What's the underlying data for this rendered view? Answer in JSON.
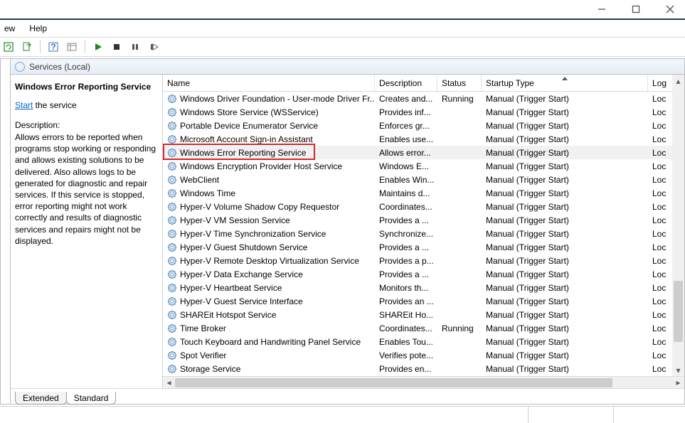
{
  "menubar": {
    "view": "ew",
    "help": "Help"
  },
  "services_header": "Services (Local)",
  "detail": {
    "title": "Windows Error Reporting Service",
    "start_link": "Start",
    "start_suffix": " the service",
    "desc_label": "Description:",
    "desc_body": "Allows errors to be reported when programs stop working or responding and allows existing solutions to be delivered. Also allows logs to be generated for diagnostic and repair services. If this service is stopped, error reporting might not work correctly and results of diagnostic services and repairs might not be displayed."
  },
  "columns": {
    "name": "Name",
    "description": "Description",
    "status": "Status",
    "startup": "Startup Type",
    "logon": "Log"
  },
  "rows": [
    {
      "name": "Windows Driver Foundation - User-mode Driver Fr...",
      "desc": "Creates and...",
      "status": "Running",
      "startup": "Manual (Trigger Start)",
      "logon": "Loc"
    },
    {
      "name": "Windows Store Service (WSService)",
      "desc": "Provides inf...",
      "status": "",
      "startup": "Manual (Trigger Start)",
      "logon": "Loc"
    },
    {
      "name": "Portable Device Enumerator Service",
      "desc": "Enforces gr...",
      "status": "",
      "startup": "Manual (Trigger Start)",
      "logon": "Loc"
    },
    {
      "name": "Microsoft Account Sign-in Assistant",
      "desc": "Enables use...",
      "status": "",
      "startup": "Manual (Trigger Start)",
      "logon": "Loc"
    },
    {
      "name": "Windows Error Reporting Service",
      "desc": "Allows error...",
      "status": "",
      "startup": "Manual (Trigger Start)",
      "logon": "Loc",
      "highlight": true
    },
    {
      "name": "Windows Encryption Provider Host Service",
      "desc": "Windows E...",
      "status": "",
      "startup": "Manual (Trigger Start)",
      "logon": "Loc"
    },
    {
      "name": "WebClient",
      "desc": "Enables Win...",
      "status": "",
      "startup": "Manual (Trigger Start)",
      "logon": "Loc"
    },
    {
      "name": "Windows Time",
      "desc": "Maintains d...",
      "status": "",
      "startup": "Manual (Trigger Start)",
      "logon": "Loc"
    },
    {
      "name": "Hyper-V Volume Shadow Copy Requestor",
      "desc": "Coordinates...",
      "status": "",
      "startup": "Manual (Trigger Start)",
      "logon": "Loc"
    },
    {
      "name": "Hyper-V VM Session Service",
      "desc": "Provides a ...",
      "status": "",
      "startup": "Manual (Trigger Start)",
      "logon": "Loc"
    },
    {
      "name": "Hyper-V Time Synchronization Service",
      "desc": "Synchronize...",
      "status": "",
      "startup": "Manual (Trigger Start)",
      "logon": "Loc"
    },
    {
      "name": "Hyper-V Guest Shutdown Service",
      "desc": "Provides a ...",
      "status": "",
      "startup": "Manual (Trigger Start)",
      "logon": "Loc"
    },
    {
      "name": "Hyper-V Remote Desktop Virtualization Service",
      "desc": "Provides a p...",
      "status": "",
      "startup": "Manual (Trigger Start)",
      "logon": "Loc"
    },
    {
      "name": "Hyper-V Data Exchange Service",
      "desc": "Provides a ...",
      "status": "",
      "startup": "Manual (Trigger Start)",
      "logon": "Loc"
    },
    {
      "name": "Hyper-V Heartbeat Service",
      "desc": "Monitors th...",
      "status": "",
      "startup": "Manual (Trigger Start)",
      "logon": "Loc"
    },
    {
      "name": "Hyper-V Guest Service Interface",
      "desc": "Provides an ...",
      "status": "",
      "startup": "Manual (Trigger Start)",
      "logon": "Loc"
    },
    {
      "name": "SHAREit Hotspot Service",
      "desc": "SHAREit Ho...",
      "status": "",
      "startup": "Manual (Trigger Start)",
      "logon": "Loc"
    },
    {
      "name": "Time Broker",
      "desc": "Coordinates...",
      "status": "Running",
      "startup": "Manual (Trigger Start)",
      "logon": "Loc"
    },
    {
      "name": "Touch Keyboard and Handwriting Panel Service",
      "desc": "Enables Tou...",
      "status": "",
      "startup": "Manual (Trigger Start)",
      "logon": "Loc"
    },
    {
      "name": "Spot Verifier",
      "desc": "Verifies pote...",
      "status": "",
      "startup": "Manual (Trigger Start)",
      "logon": "Loc"
    },
    {
      "name": "Storage Service",
      "desc": "Provides en...",
      "status": "",
      "startup": "Manual (Trigger Start)",
      "logon": "Loc"
    }
  ],
  "tabs": {
    "extended": "Extended",
    "standard": "Standard"
  }
}
